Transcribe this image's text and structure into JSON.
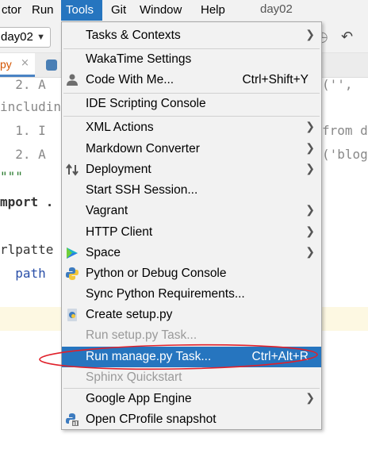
{
  "menubar": {
    "items": [
      "ctor",
      "Run",
      "Tools",
      "Git",
      "Window",
      "Help"
    ],
    "project_title": "day02"
  },
  "toolbar": {
    "project_combo": "day02"
  },
  "tabs": {
    "active_tab": "py",
    "close": "×"
  },
  "editor": {
    "lines": [
      "  2. A",
      "includin",
      "  1. I",
      "  2. A",
      "\"\"\"",
      "mport .",
      "",
      "rlpatte",
      "  path"
    ],
    "right_fragments": [
      "('', ",
      "from d",
      "('blog"
    ]
  },
  "menu": {
    "items": [
      {
        "label": "Tasks & Contexts",
        "shortcut": "",
        "submenu": true,
        "disabled": false,
        "icon": ""
      },
      {
        "label": "WakaTime Settings",
        "shortcut": "",
        "submenu": false,
        "disabled": false,
        "icon": ""
      },
      {
        "label": "Code With Me...",
        "shortcut": "Ctrl+Shift+Y",
        "submenu": false,
        "disabled": false,
        "icon": "person-icon"
      },
      {
        "label": "IDE Scripting Console",
        "shortcut": "",
        "submenu": false,
        "disabled": false,
        "icon": ""
      },
      {
        "label": "XML Actions",
        "shortcut": "",
        "submenu": true,
        "disabled": false,
        "icon": ""
      },
      {
        "label": "Markdown Converter",
        "shortcut": "",
        "submenu": true,
        "disabled": false,
        "icon": ""
      },
      {
        "label": "Deployment",
        "shortcut": "",
        "submenu": true,
        "disabled": false,
        "icon": "deployment-icon"
      },
      {
        "label": "Start SSH Session...",
        "shortcut": "",
        "submenu": false,
        "disabled": false,
        "icon": ""
      },
      {
        "label": "Vagrant",
        "shortcut": "",
        "submenu": true,
        "disabled": false,
        "icon": ""
      },
      {
        "label": "HTTP Client",
        "shortcut": "",
        "submenu": true,
        "disabled": false,
        "icon": ""
      },
      {
        "label": "Space",
        "shortcut": "",
        "submenu": true,
        "disabled": false,
        "icon": "space-icon"
      },
      {
        "label": "Python or Debug Console",
        "shortcut": "",
        "submenu": false,
        "disabled": false,
        "icon": "python-icon"
      },
      {
        "label": "Sync Python Requirements...",
        "shortcut": "",
        "submenu": false,
        "disabled": false,
        "icon": ""
      },
      {
        "label": "Create setup.py",
        "shortcut": "",
        "submenu": false,
        "disabled": false,
        "icon": "python-file-icon"
      },
      {
        "label": "Run setup.py Task...",
        "shortcut": "",
        "submenu": false,
        "disabled": true,
        "icon": ""
      },
      {
        "label": "Run manage.py Task...",
        "shortcut": "Ctrl+Alt+R",
        "submenu": false,
        "disabled": false,
        "icon": "",
        "selected": true
      },
      {
        "label": "Sphinx Quickstart",
        "shortcut": "",
        "submenu": false,
        "disabled": true,
        "icon": ""
      },
      {
        "label": "Google App Engine",
        "shortcut": "",
        "submenu": true,
        "disabled": false,
        "icon": ""
      },
      {
        "label": "Open CProfile snapshot",
        "shortcut": "",
        "submenu": false,
        "disabled": false,
        "icon": "profiler-icon"
      }
    ]
  },
  "colors": {
    "selection": "#2675bf",
    "annotation": "#e0202a"
  }
}
